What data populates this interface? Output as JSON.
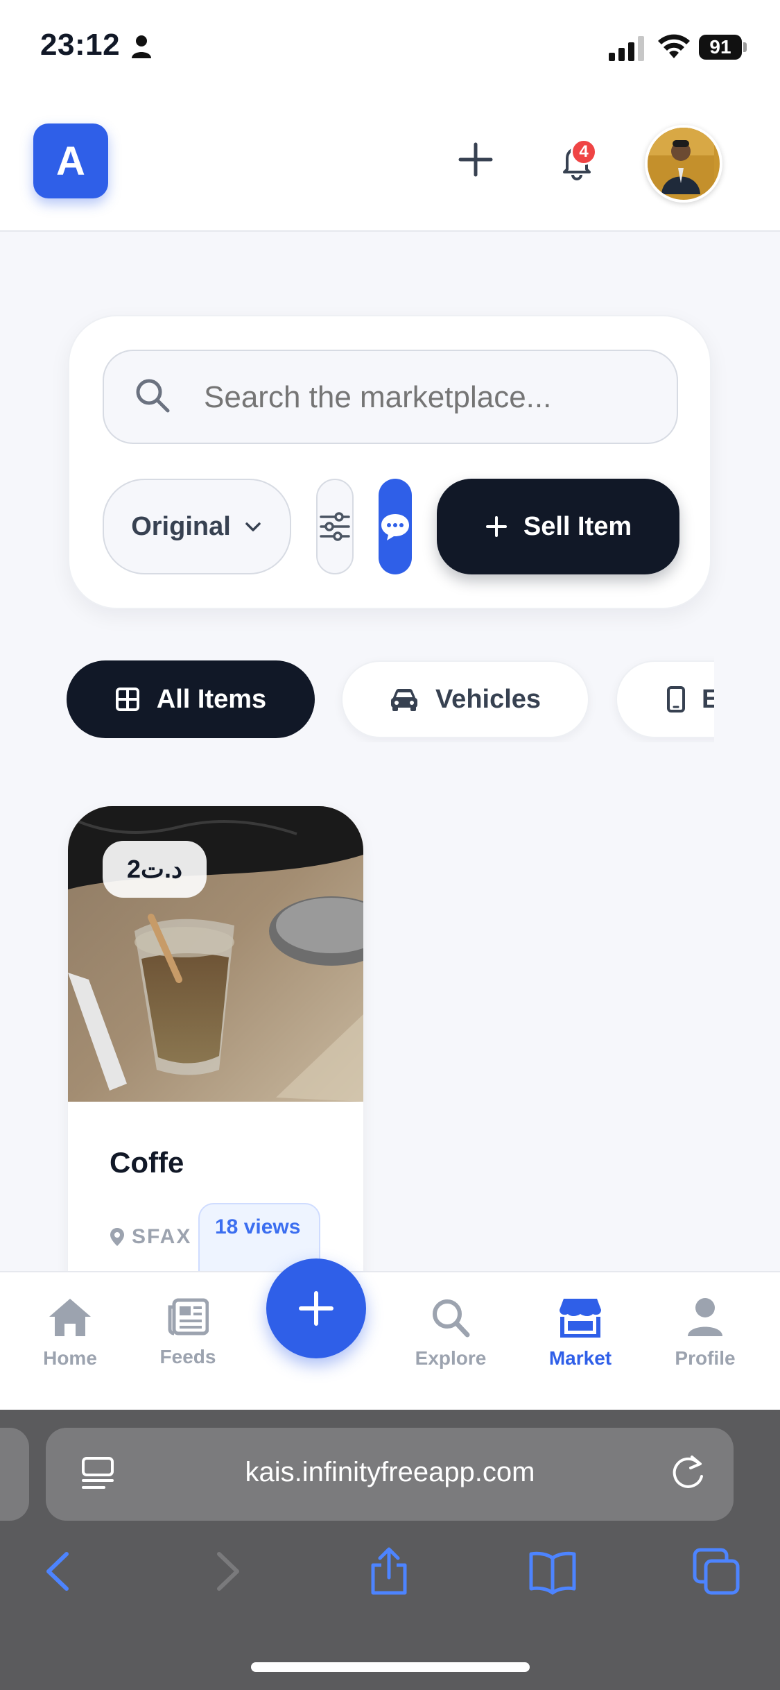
{
  "status": {
    "time": "23:12",
    "battery": "91"
  },
  "header": {
    "logo_letter": "A",
    "notification_count": "4"
  },
  "search": {
    "placeholder": "Search the marketplace...",
    "value": ""
  },
  "toolbar": {
    "sort_label": "Original",
    "sell_label": "Sell Item"
  },
  "categories": [
    {
      "label": "All Items",
      "icon": "grid-icon",
      "active": true
    },
    {
      "label": "Vehicles",
      "icon": "car-icon",
      "active": false
    },
    {
      "label": "E",
      "icon": "phone-icon",
      "active": false
    }
  ],
  "listings": [
    {
      "price": "2د.ت",
      "title": "Coffe",
      "location": "SFAX",
      "views": "18 views"
    }
  ],
  "bottom_nav": [
    {
      "label": "Home",
      "icon": "home-icon"
    },
    {
      "label": "Feeds",
      "icon": "newspaper-icon"
    },
    {
      "label": "Explore",
      "icon": "search-icon"
    },
    {
      "label": "Market",
      "icon": "store-icon",
      "active": true
    },
    {
      "label": "Profile",
      "icon": "user-icon"
    }
  ],
  "browser": {
    "url": "kais.infinityfreeapp.com"
  },
  "colors": {
    "accent": "#2f5fe8",
    "dark": "#111827",
    "badge": "#ef4444"
  }
}
